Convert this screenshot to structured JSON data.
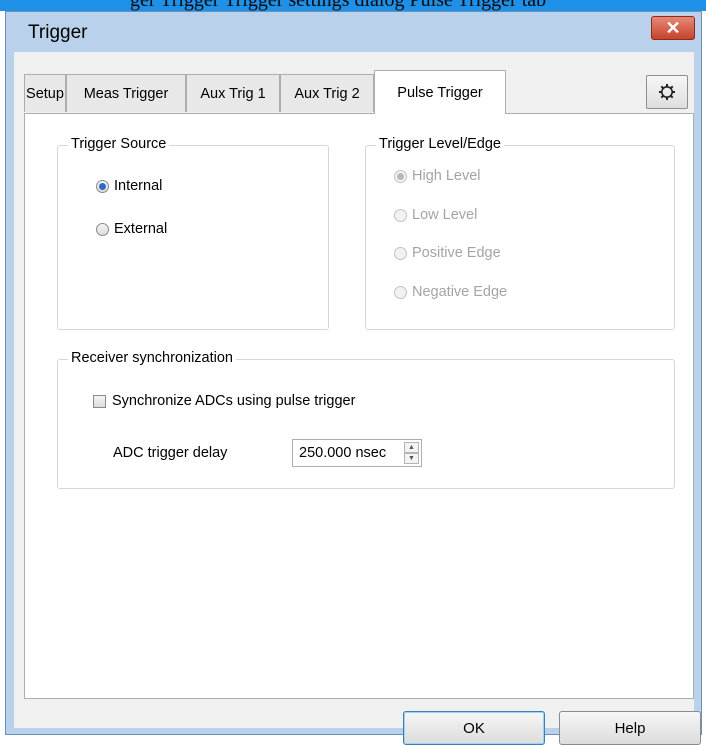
{
  "caption_strip": "ger Trigger Trigger settings dialog Pulse Trigger tab",
  "window": {
    "title": "Trigger",
    "close_glyph": "✕"
  },
  "tabs": [
    {
      "label": "Setup",
      "active": false
    },
    {
      "label": "Meas Trigger",
      "active": false
    },
    {
      "label": "Aux Trig 1",
      "active": false
    },
    {
      "label": "Aux Trig 2",
      "active": false
    },
    {
      "label": "Pulse Trigger",
      "active": true
    }
  ],
  "gear_icon": "gear-icon",
  "trigger_source": {
    "title": "Trigger Source",
    "options": [
      {
        "label": "Internal",
        "checked": true,
        "enabled": true
      },
      {
        "label": "External",
        "checked": false,
        "enabled": true
      }
    ]
  },
  "trigger_level": {
    "title": "Trigger Level/Edge",
    "options": [
      {
        "label": "High Level",
        "checked": true,
        "enabled": false
      },
      {
        "label": "Low Level",
        "checked": false,
        "enabled": false
      },
      {
        "label": "Positive Edge",
        "checked": false,
        "enabled": false
      },
      {
        "label": "Negative Edge",
        "checked": false,
        "enabled": false
      }
    ]
  },
  "receiver_sync": {
    "title": "Receiver synchronization",
    "checkbox_label": "Synchronize ADCs using pulse trigger",
    "checkbox_checked": false,
    "delay_label": "ADC trigger delay",
    "delay_value": "250.000 nsec"
  },
  "buttons": {
    "ok": "OK",
    "help": "Help"
  },
  "colors": {
    "titlebar": "#b9d1ea",
    "close": "#c7432c",
    "accent_radio": "#2f6cc2"
  }
}
